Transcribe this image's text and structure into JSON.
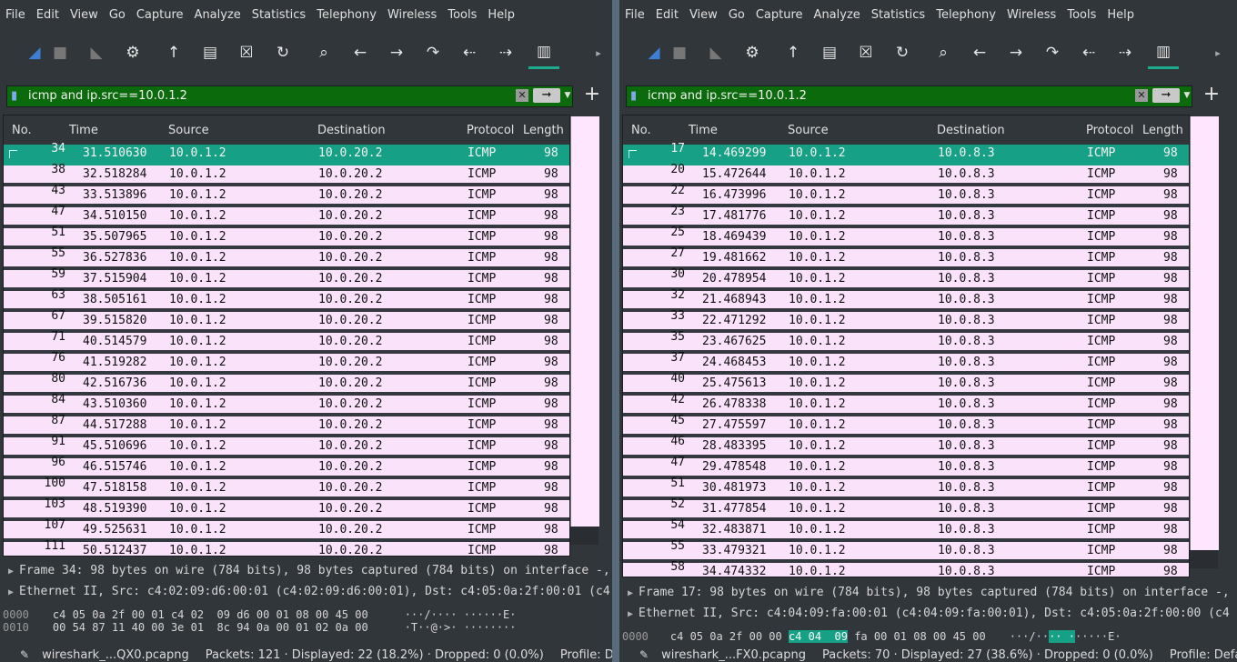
{
  "menu": [
    "File",
    "Edit",
    "View",
    "Go",
    "Capture",
    "Analyze",
    "Statistics",
    "Telephony",
    "Wireless",
    "Tools",
    "Help"
  ],
  "columns": {
    "no": "No.",
    "time": "Time",
    "source": "Source",
    "destination": "Destination",
    "protocol": "Protocol",
    "length": "Length"
  },
  "toolbar_icons": [
    "shark-fin-icon",
    "stop-icon",
    "restart-icon",
    "options-gear-icon",
    "open-file-icon",
    "save-file-icon",
    "close-file-icon",
    "reload-file-icon",
    "find-icon",
    "go-back-icon",
    "go-forward-icon",
    "go-to-packet-icon",
    "first-packet-icon",
    "last-packet-icon",
    "autoscroll-icon",
    "more-icon"
  ],
  "left": {
    "filter": "icmp and ip.src==10.0.1.2",
    "packets": [
      {
        "no": "34",
        "time": "31.510630",
        "src": "10.0.1.2",
        "dst": "10.0.20.2",
        "proto": "ICMP",
        "len": "98",
        "selected": true
      },
      {
        "no": "38",
        "time": "32.518284",
        "src": "10.0.1.2",
        "dst": "10.0.20.2",
        "proto": "ICMP",
        "len": "98"
      },
      {
        "no": "43",
        "time": "33.513896",
        "src": "10.0.1.2",
        "dst": "10.0.20.2",
        "proto": "ICMP",
        "len": "98"
      },
      {
        "no": "47",
        "time": "34.510150",
        "src": "10.0.1.2",
        "dst": "10.0.20.2",
        "proto": "ICMP",
        "len": "98"
      },
      {
        "no": "51",
        "time": "35.507965",
        "src": "10.0.1.2",
        "dst": "10.0.20.2",
        "proto": "ICMP",
        "len": "98"
      },
      {
        "no": "55",
        "time": "36.527836",
        "src": "10.0.1.2",
        "dst": "10.0.20.2",
        "proto": "ICMP",
        "len": "98"
      },
      {
        "no": "59",
        "time": "37.515904",
        "src": "10.0.1.2",
        "dst": "10.0.20.2",
        "proto": "ICMP",
        "len": "98"
      },
      {
        "no": "63",
        "time": "38.505161",
        "src": "10.0.1.2",
        "dst": "10.0.20.2",
        "proto": "ICMP",
        "len": "98"
      },
      {
        "no": "67",
        "time": "39.515820",
        "src": "10.0.1.2",
        "dst": "10.0.20.2",
        "proto": "ICMP",
        "len": "98"
      },
      {
        "no": "71",
        "time": "40.514579",
        "src": "10.0.1.2",
        "dst": "10.0.20.2",
        "proto": "ICMP",
        "len": "98"
      },
      {
        "no": "76",
        "time": "41.519282",
        "src": "10.0.1.2",
        "dst": "10.0.20.2",
        "proto": "ICMP",
        "len": "98"
      },
      {
        "no": "80",
        "time": "42.516736",
        "src": "10.0.1.2",
        "dst": "10.0.20.2",
        "proto": "ICMP",
        "len": "98"
      },
      {
        "no": "84",
        "time": "43.510360",
        "src": "10.0.1.2",
        "dst": "10.0.20.2",
        "proto": "ICMP",
        "len": "98"
      },
      {
        "no": "87",
        "time": "44.517288",
        "src": "10.0.1.2",
        "dst": "10.0.20.2",
        "proto": "ICMP",
        "len": "98"
      },
      {
        "no": "91",
        "time": "45.510696",
        "src": "10.0.1.2",
        "dst": "10.0.20.2",
        "proto": "ICMP",
        "len": "98"
      },
      {
        "no": "96",
        "time": "46.515746",
        "src": "10.0.1.2",
        "dst": "10.0.20.2",
        "proto": "ICMP",
        "len": "98"
      },
      {
        "no": "100",
        "time": "47.518158",
        "src": "10.0.1.2",
        "dst": "10.0.20.2",
        "proto": "ICMP",
        "len": "98"
      },
      {
        "no": "103",
        "time": "48.519390",
        "src": "10.0.1.2",
        "dst": "10.0.20.2",
        "proto": "ICMP",
        "len": "98"
      },
      {
        "no": "107",
        "time": "49.525631",
        "src": "10.0.1.2",
        "dst": "10.0.20.2",
        "proto": "ICMP",
        "len": "98"
      },
      {
        "no": "111",
        "time": "50.512437",
        "src": "10.0.1.2",
        "dst": "10.0.20.2",
        "proto": "ICMP",
        "len": "98"
      }
    ],
    "details": [
      "Frame 34: 98 bytes on wire (784 bits), 98 bytes captured (784 bits) on interface -,",
      "Ethernet II, Src: c4:02:09:d6:00:01 (c4:02:09:d6:00:01), Dst: c4:05:0a:2f:00:01 (c4"
    ],
    "hex": [
      {
        "offset": "0000",
        "bytes": "c4 05 0a 2f 00 01 c4 02  09 d6 00 01 08 00 45 00",
        "ascii": "···/···· ······E·"
      },
      {
        "offset": "0010",
        "bytes": "00 54 87 11 40 00 3e 01  8c 94 0a 00 01 02 0a 00",
        "ascii": "·T··@·>· ········"
      }
    ],
    "status": {
      "file": "wireshark_...QX0.pcapng",
      "packets": "Packets: 121 · Displayed: 22 (18.2%) · Dropped: 0 (0.0%)",
      "profile": "Profile: Default",
      "led_color": "#5f8fd0"
    }
  },
  "right": {
    "filter": "icmp and ip.src==10.0.1.2",
    "packets": [
      {
        "no": "17",
        "time": "14.469299",
        "src": "10.0.1.2",
        "dst": "10.0.8.3",
        "proto": "ICMP",
        "len": "98",
        "selected": true
      },
      {
        "no": "20",
        "time": "15.472644",
        "src": "10.0.1.2",
        "dst": "10.0.8.3",
        "proto": "ICMP",
        "len": "98"
      },
      {
        "no": "22",
        "time": "16.473996",
        "src": "10.0.1.2",
        "dst": "10.0.8.3",
        "proto": "ICMP",
        "len": "98"
      },
      {
        "no": "23",
        "time": "17.481776",
        "src": "10.0.1.2",
        "dst": "10.0.8.3",
        "proto": "ICMP",
        "len": "98"
      },
      {
        "no": "25",
        "time": "18.469439",
        "src": "10.0.1.2",
        "dst": "10.0.8.3",
        "proto": "ICMP",
        "len": "98"
      },
      {
        "no": "27",
        "time": "19.481662",
        "src": "10.0.1.2",
        "dst": "10.0.8.3",
        "proto": "ICMP",
        "len": "98"
      },
      {
        "no": "30",
        "time": "20.478954",
        "src": "10.0.1.2",
        "dst": "10.0.8.3",
        "proto": "ICMP",
        "len": "98"
      },
      {
        "no": "32",
        "time": "21.468943",
        "src": "10.0.1.2",
        "dst": "10.0.8.3",
        "proto": "ICMP",
        "len": "98"
      },
      {
        "no": "33",
        "time": "22.471292",
        "src": "10.0.1.2",
        "dst": "10.0.8.3",
        "proto": "ICMP",
        "len": "98"
      },
      {
        "no": "35",
        "time": "23.467625",
        "src": "10.0.1.2",
        "dst": "10.0.8.3",
        "proto": "ICMP",
        "len": "98"
      },
      {
        "no": "37",
        "time": "24.468453",
        "src": "10.0.1.2",
        "dst": "10.0.8.3",
        "proto": "ICMP",
        "len": "98"
      },
      {
        "no": "40",
        "time": "25.475613",
        "src": "10.0.1.2",
        "dst": "10.0.8.3",
        "proto": "ICMP",
        "len": "98"
      },
      {
        "no": "42",
        "time": "26.478338",
        "src": "10.0.1.2",
        "dst": "10.0.8.3",
        "proto": "ICMP",
        "len": "98"
      },
      {
        "no": "45",
        "time": "27.475597",
        "src": "10.0.1.2",
        "dst": "10.0.8.3",
        "proto": "ICMP",
        "len": "98"
      },
      {
        "no": "46",
        "time": "28.483395",
        "src": "10.0.1.2",
        "dst": "10.0.8.3",
        "proto": "ICMP",
        "len": "98"
      },
      {
        "no": "47",
        "time": "29.478548",
        "src": "10.0.1.2",
        "dst": "10.0.8.3",
        "proto": "ICMP",
        "len": "98"
      },
      {
        "no": "51",
        "time": "30.481973",
        "src": "10.0.1.2",
        "dst": "10.0.8.3",
        "proto": "ICMP",
        "len": "98"
      },
      {
        "no": "52",
        "time": "31.477854",
        "src": "10.0.1.2",
        "dst": "10.0.8.3",
        "proto": "ICMP",
        "len": "98"
      },
      {
        "no": "54",
        "time": "32.483871",
        "src": "10.0.1.2",
        "dst": "10.0.8.3",
        "proto": "ICMP",
        "len": "98"
      },
      {
        "no": "55",
        "time": "33.479321",
        "src": "10.0.1.2",
        "dst": "10.0.8.3",
        "proto": "ICMP",
        "len": "98"
      },
      {
        "no": "58",
        "time": "34.474332",
        "src": "10.0.1.2",
        "dst": "10.0.8.3",
        "proto": "ICMP",
        "len": "98"
      }
    ],
    "details": [
      "Frame 17: 98 bytes on wire (784 bits), 98 bytes captured (784 bits) on interface -,",
      "Ethernet II, Src: c4:04:09:fa:00:01 (c4:04:09:fa:00:01), Dst: c4:05:0a:2f:00:00 (c4"
    ],
    "hex": [
      {
        "offset": "0000",
        "bytes_a": "c4 05 0a 2f 00 00 ",
        "bytes_hl": "c4 04  09",
        "bytes_b": " fa 00 01 08 00 45 00",
        "ascii_a": "···/··",
        "ascii_hl": "·· ·",
        "ascii_b": "·····E·"
      }
    ],
    "status": {
      "file": "wireshark_...FX0.pcapng",
      "packets": "Packets: 70 · Displayed: 27 (38.6%) · Dropped: 0 (0.0%)",
      "profile": "Profile: Default",
      "led_color": "#e6d34a"
    }
  },
  "colors": {
    "selected_row": "#16a085",
    "row_bg": "#fbe2fb",
    "window_bg": "#31363b",
    "filter_ok": "#0b6a0b"
  }
}
